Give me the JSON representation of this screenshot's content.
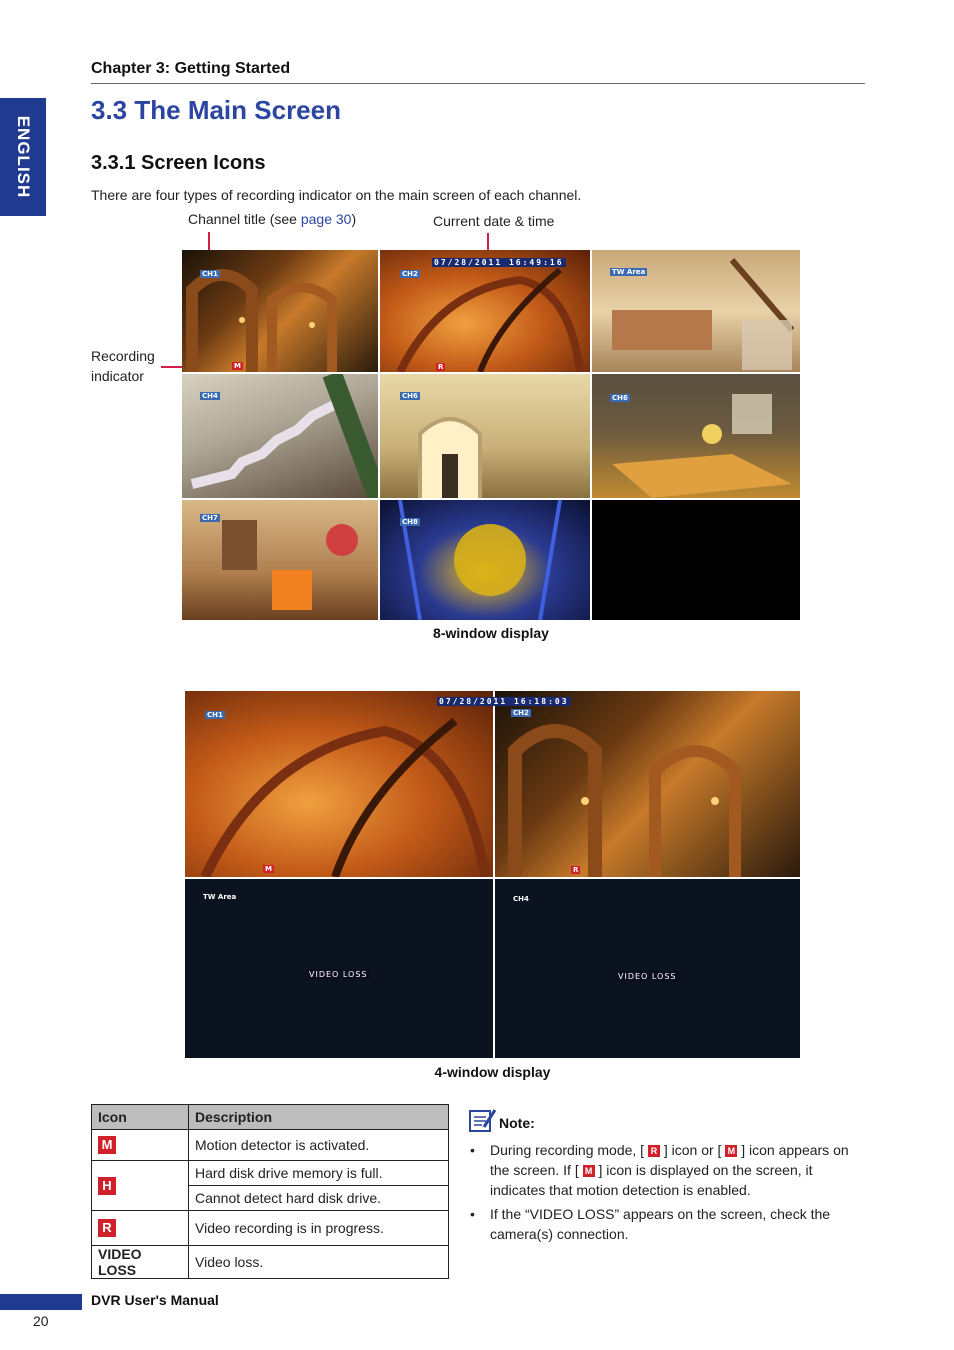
{
  "header": {
    "chapter": "Chapter 3: Getting Started",
    "side_tab": "ENGLISH"
  },
  "section": {
    "title": "3.3 The Main Screen",
    "subtitle": "3.3.1 Screen Icons",
    "intro": "There are four types of recording indicator on the main screen of each channel."
  },
  "callouts": {
    "channel_title_pre": "Channel title (see ",
    "channel_title_link": "page 30",
    "channel_title_post": ")",
    "date_time": "Current date & time",
    "recording_line1": "Recording",
    "recording_line2": "indicator"
  },
  "grid8": {
    "caption": "8-window display",
    "datetime": "07/28/2011 16:49:16",
    "cells": [
      {
        "label": "CH1",
        "rec": "M"
      },
      {
        "label": "CH2",
        "rec": "R"
      },
      {
        "label": "TW Area",
        "rec": ""
      },
      {
        "label": "CH4",
        "rec": ""
      },
      {
        "label": "CH6",
        "rec": ""
      },
      {
        "label": "CH6",
        "rec": ""
      },
      {
        "label": "CH7",
        "rec": ""
      },
      {
        "label": "CH8",
        "rec": ""
      }
    ]
  },
  "grid4": {
    "caption": "4-window display",
    "datetime": "07/28/2011 16:18:03",
    "cells": [
      {
        "label": "CH1",
        "rec": "M"
      },
      {
        "label": "CH2",
        "rec": "R"
      },
      {
        "label": "TW Area",
        "status": "VIDEO LOSS"
      },
      {
        "label": "CH4",
        "status": "VIDEO LOSS"
      }
    ]
  },
  "icon_table": {
    "col_icon": "Icon",
    "col_desc": "Description",
    "rows": [
      {
        "icon": "M",
        "desc": "Motion detector is activated."
      },
      {
        "icon": "H",
        "desc": "Hard disk drive memory is full."
      },
      {
        "icon": "",
        "desc": "Cannot detect hard disk drive."
      },
      {
        "icon": "R",
        "desc": "Video recording is in progress."
      },
      {
        "icon": "VIDEO LOSS",
        "desc": "Video loss."
      }
    ]
  },
  "note": {
    "title": "Note:",
    "b1_a": "During recording mode, [",
    "b1_r": "R",
    "b1_b": "] icon or [",
    "b1_m": "M",
    "b1_c": "] icon appears on the screen. If [",
    "b1_m2": "M",
    "b1_d": "] icon is displayed on the screen, it indicates that motion detection is enabled.",
    "b2": "If the “VIDEO LOSS” appears on the screen, check the camera(s) connection."
  },
  "footer": {
    "title": "DVR User's Manual",
    "page": "20"
  },
  "colors": {
    "accent": "#2b45a0",
    "tab": "#1f3a8f",
    "rec_badge": "#d0202a",
    "pointer": "#d0204a"
  }
}
